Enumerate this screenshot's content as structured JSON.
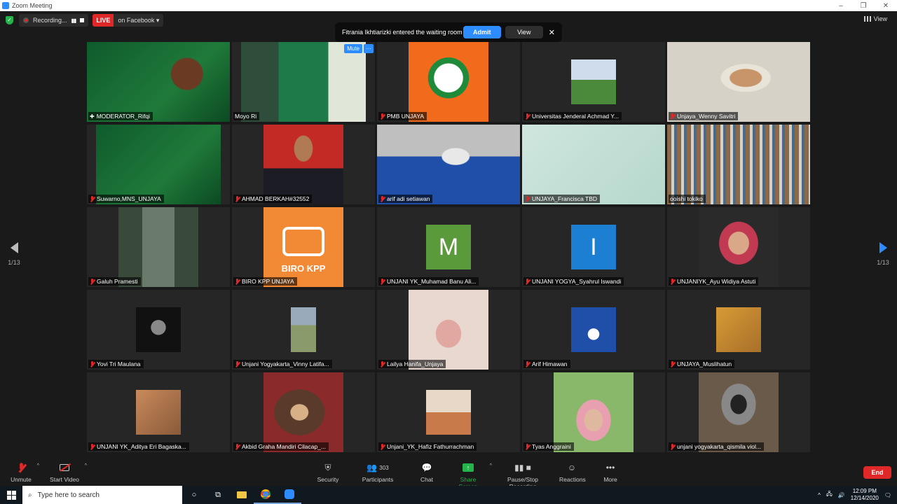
{
  "window": {
    "title": "Zoom Meeting"
  },
  "topbar": {
    "recording_label": "Recording...",
    "live_label": "LIVE",
    "live_target": "on Facebook",
    "view_label": "View"
  },
  "notification": {
    "message": "Fitrania Ikhtiarizki entered the waiting room",
    "admit": "Admit",
    "view": "View"
  },
  "pagination": {
    "left": "1/13",
    "right": "1/13"
  },
  "participants": [
    {
      "name": "MODERATOR_Rifqi",
      "muted": false,
      "pinned": true,
      "active": true
    },
    {
      "name": "Moyo Ri",
      "muted": false,
      "mute_button": "Mute",
      "more_button": "···"
    },
    {
      "name": "PMB UNJAYA",
      "muted": true
    },
    {
      "name": "Universitas Jenderal Achmad Y...",
      "muted": true
    },
    {
      "name": "Unjaya_Wenny Savitri",
      "muted": true
    },
    {
      "name": "Suwarno,MNS_UNJAYA",
      "muted": true
    },
    {
      "name": "AHMAD BERKAH#32552",
      "muted": true
    },
    {
      "name": "arif adi setiawan",
      "muted": true
    },
    {
      "name": "UNJAYA_Francisca TBD",
      "muted": true
    },
    {
      "name": "ooishi tokiko",
      "muted": false
    },
    {
      "name": "Galuh Pramesti",
      "muted": true
    },
    {
      "name": "BIRO KPP UNJAYA",
      "muted": true,
      "logo_text": "BIRO KPP"
    },
    {
      "name": "UNJANI YK_Muhamad Banu Ali...",
      "muted": true,
      "avatar_letter": "M",
      "avatar_color": "#5a9a3a"
    },
    {
      "name": "UNJANI YOGYA_Syahrul Iswandi",
      "muted": true,
      "avatar_letter": "I",
      "avatar_color": "#1d7fd1"
    },
    {
      "name": "UNJANIYK_Ayu Widiya Astuti",
      "muted": true
    },
    {
      "name": "Yovi Tri Maulana",
      "muted": true
    },
    {
      "name": "Unjani Yogyakarta_Vinny Latifa...",
      "muted": true
    },
    {
      "name": "Lailya Hanifa_Unjaya",
      "muted": true
    },
    {
      "name": "Arif Himawan",
      "muted": true
    },
    {
      "name": "UNJAYA_Muslihatun",
      "muted": true
    },
    {
      "name": "UNJANI YK_Aditya Eri Bagaska...",
      "muted": true
    },
    {
      "name": "Akbid Graha Mandiri Cilacap_...",
      "muted": true
    },
    {
      "name": "Unjani_YK_Hafiz Fathurrachman",
      "muted": true
    },
    {
      "name": "Tyas Anggraini",
      "muted": true
    },
    {
      "name": "unjani yogyakarta_qismila viol...",
      "muted": true
    }
  ],
  "toolbar": {
    "unmute": "Unmute",
    "start_video": "Start Video",
    "security": "Security",
    "participants": "Participants",
    "participant_count": "303",
    "chat": "Chat",
    "share_screen": "Share Screen",
    "recording": "Pause/Stop Recording",
    "reactions": "Reactions",
    "more": "More",
    "end": "End"
  },
  "taskbar": {
    "search_placeholder": "Type here to search",
    "time": "12:09 PM",
    "date": "12/14/2020"
  },
  "colors": {
    "accent": "#2d8cff",
    "end": "#e02828",
    "share": "#25b34b",
    "active_speaker": "#e8e44a"
  }
}
